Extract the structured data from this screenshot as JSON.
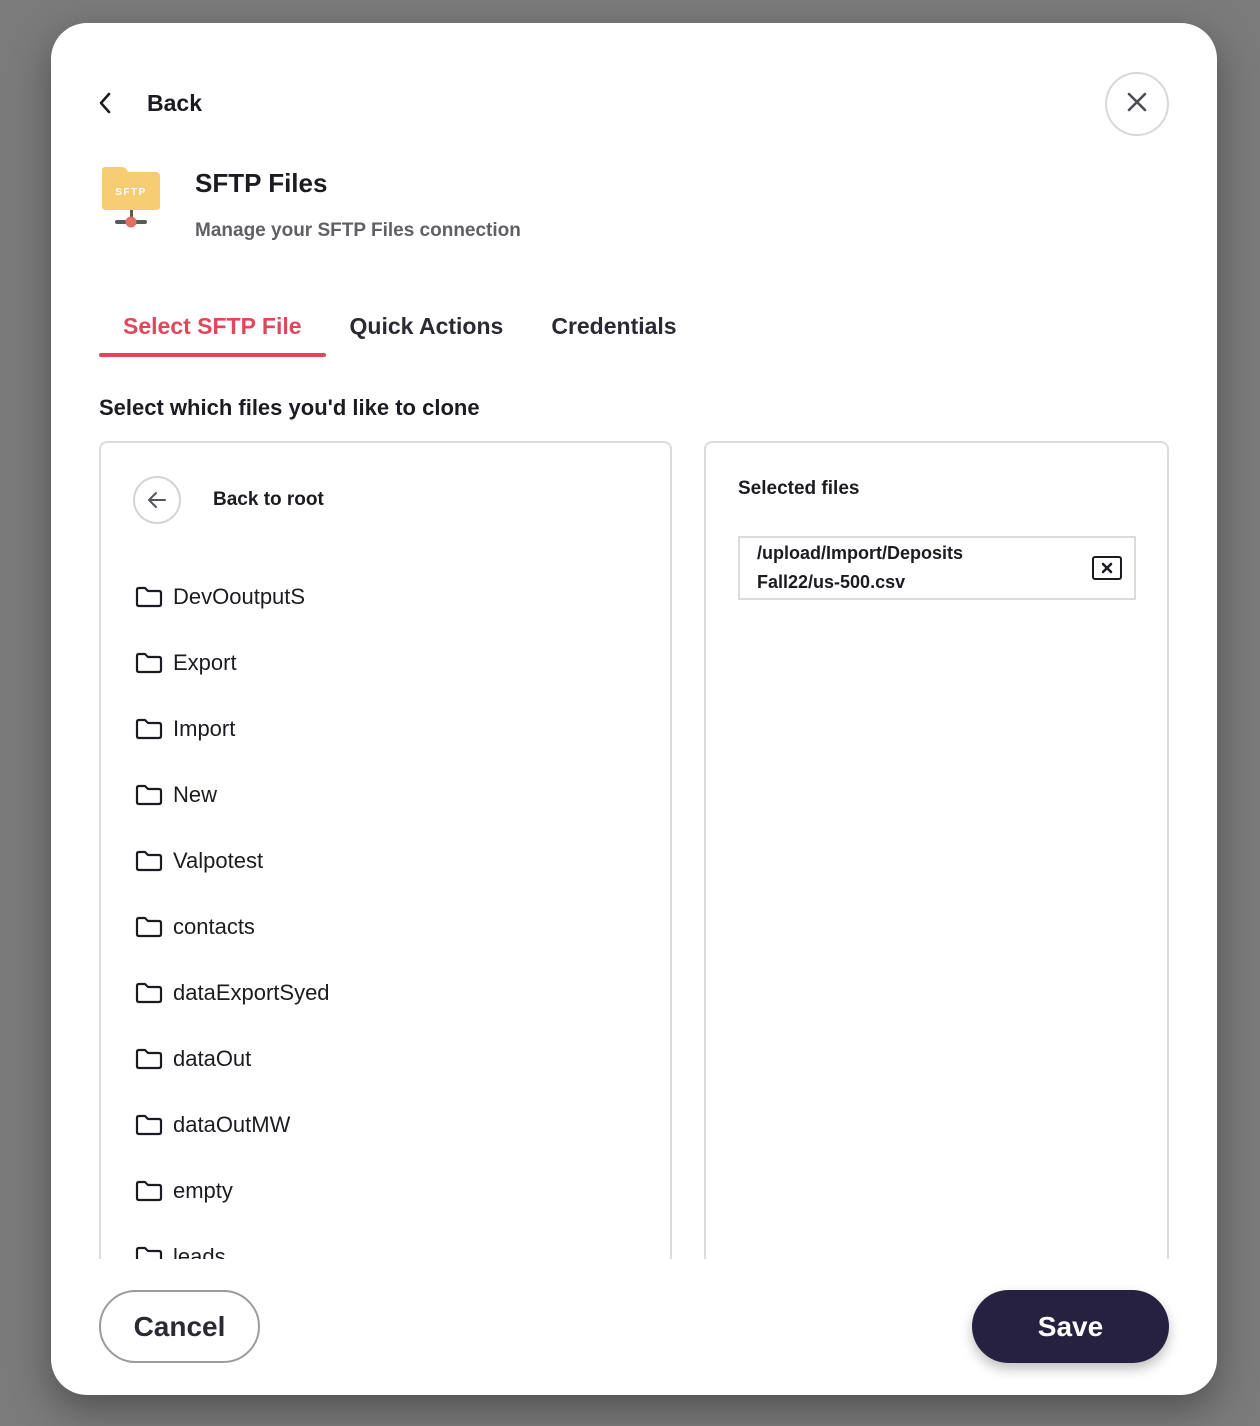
{
  "nav": {
    "back_label": "Back",
    "close_icon": "close-icon"
  },
  "header": {
    "icon_text": "SFTP",
    "title": "SFTP Files",
    "subtitle": "Manage your SFTP Files connection"
  },
  "tabs": [
    {
      "label": "Select SFTP File",
      "active": true
    },
    {
      "label": "Quick Actions",
      "active": false
    },
    {
      "label": "Credentials",
      "active": false
    }
  ],
  "section_title": "Select which files you'd like to clone",
  "browser": {
    "back_to_root_label": "Back to root",
    "folders": [
      "DevOoutputS",
      "Export",
      "Import",
      "New",
      "Valpotest",
      "contacts",
      "dataExportSyed",
      "dataOut",
      "dataOutMW",
      "empty",
      "leads"
    ]
  },
  "selected": {
    "title": "Selected files",
    "files": [
      {
        "line1": "/upload/Import/Deposits",
        "line2": "Fall22/us-500.csv"
      }
    ]
  },
  "footer": {
    "cancel_label": "Cancel",
    "save_label": "Save"
  },
  "colors": {
    "accent": "#e0475a",
    "primary_button": "#262140",
    "folder_icon": "#f7cd74",
    "node_dot": "#e0705f"
  }
}
